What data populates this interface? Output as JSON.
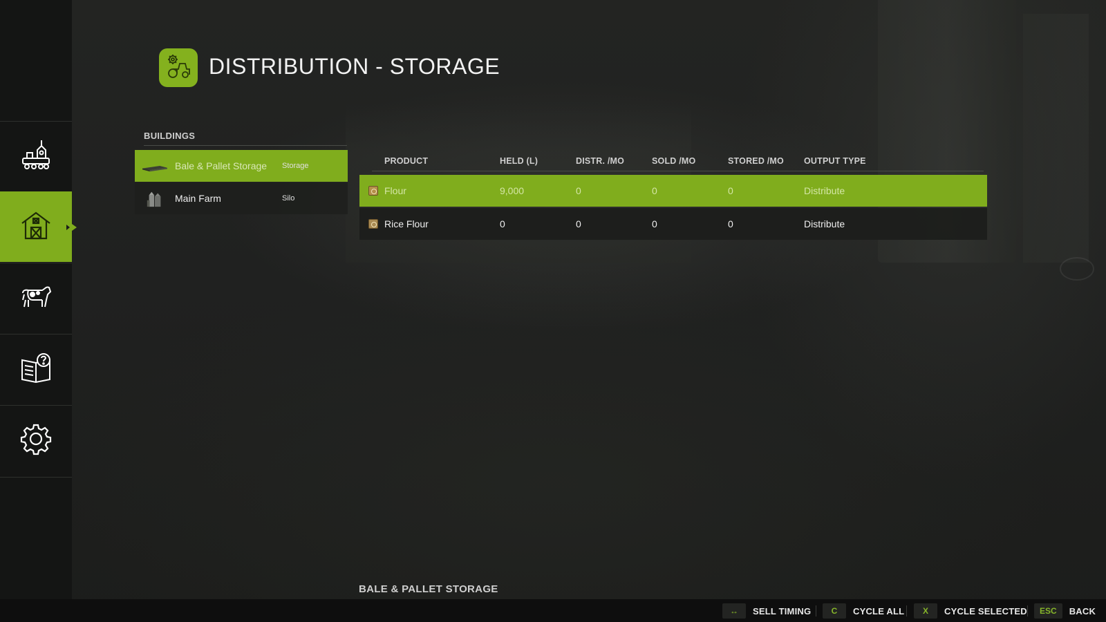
{
  "header": {
    "title": "DISTRIBUTION - STORAGE",
    "icon": "tractor-gear-icon",
    "accent_color": "#80ad1d"
  },
  "sidebar": {
    "items": [
      {
        "name": "production",
        "icon": "production-chains-icon",
        "active": false
      },
      {
        "name": "buildings",
        "icon": "barn-icon",
        "active": true
      },
      {
        "name": "animals",
        "icon": "cow-icon",
        "active": false
      },
      {
        "name": "help",
        "icon": "help-book-icon",
        "active": false
      },
      {
        "name": "settings",
        "icon": "gear-icon",
        "active": false
      }
    ]
  },
  "buildings": {
    "label": "BUILDINGS",
    "items": [
      {
        "name": "Bale & Pallet Storage",
        "type": "Storage",
        "icon": "pallet-storage-icon",
        "selected": true
      },
      {
        "name": "Main Farm",
        "type": "Silo",
        "icon": "silo-icon",
        "selected": false
      }
    ]
  },
  "products": {
    "columns": {
      "product": "PRODUCT",
      "held": "HELD (L)",
      "distr": "DISTR. /MO",
      "sold": "SOLD /MO",
      "stored": "STORED /MO",
      "output": "OUTPUT TYPE"
    },
    "rows": [
      {
        "product": "Flour",
        "held": "9,000",
        "distr": "0",
        "sold": "0",
        "stored": "0",
        "output": "Distribute",
        "icon": "flour-sack-icon",
        "selected": true
      },
      {
        "product": "Rice Flour",
        "held": "0",
        "distr": "0",
        "sold": "0",
        "stored": "0",
        "output": "Distribute",
        "icon": "rice-flour-sack-icon",
        "selected": false
      }
    ]
  },
  "selected_caption": "BALE & PALLET STORAGE",
  "footer": {
    "hints": [
      {
        "key": "↔",
        "label": "SELL TIMING"
      },
      {
        "key": "C",
        "label": "CYCLE ALL"
      },
      {
        "key": "X",
        "label": "CYCLE SELECTED"
      },
      {
        "key": "ESC",
        "label": "BACK"
      }
    ]
  }
}
